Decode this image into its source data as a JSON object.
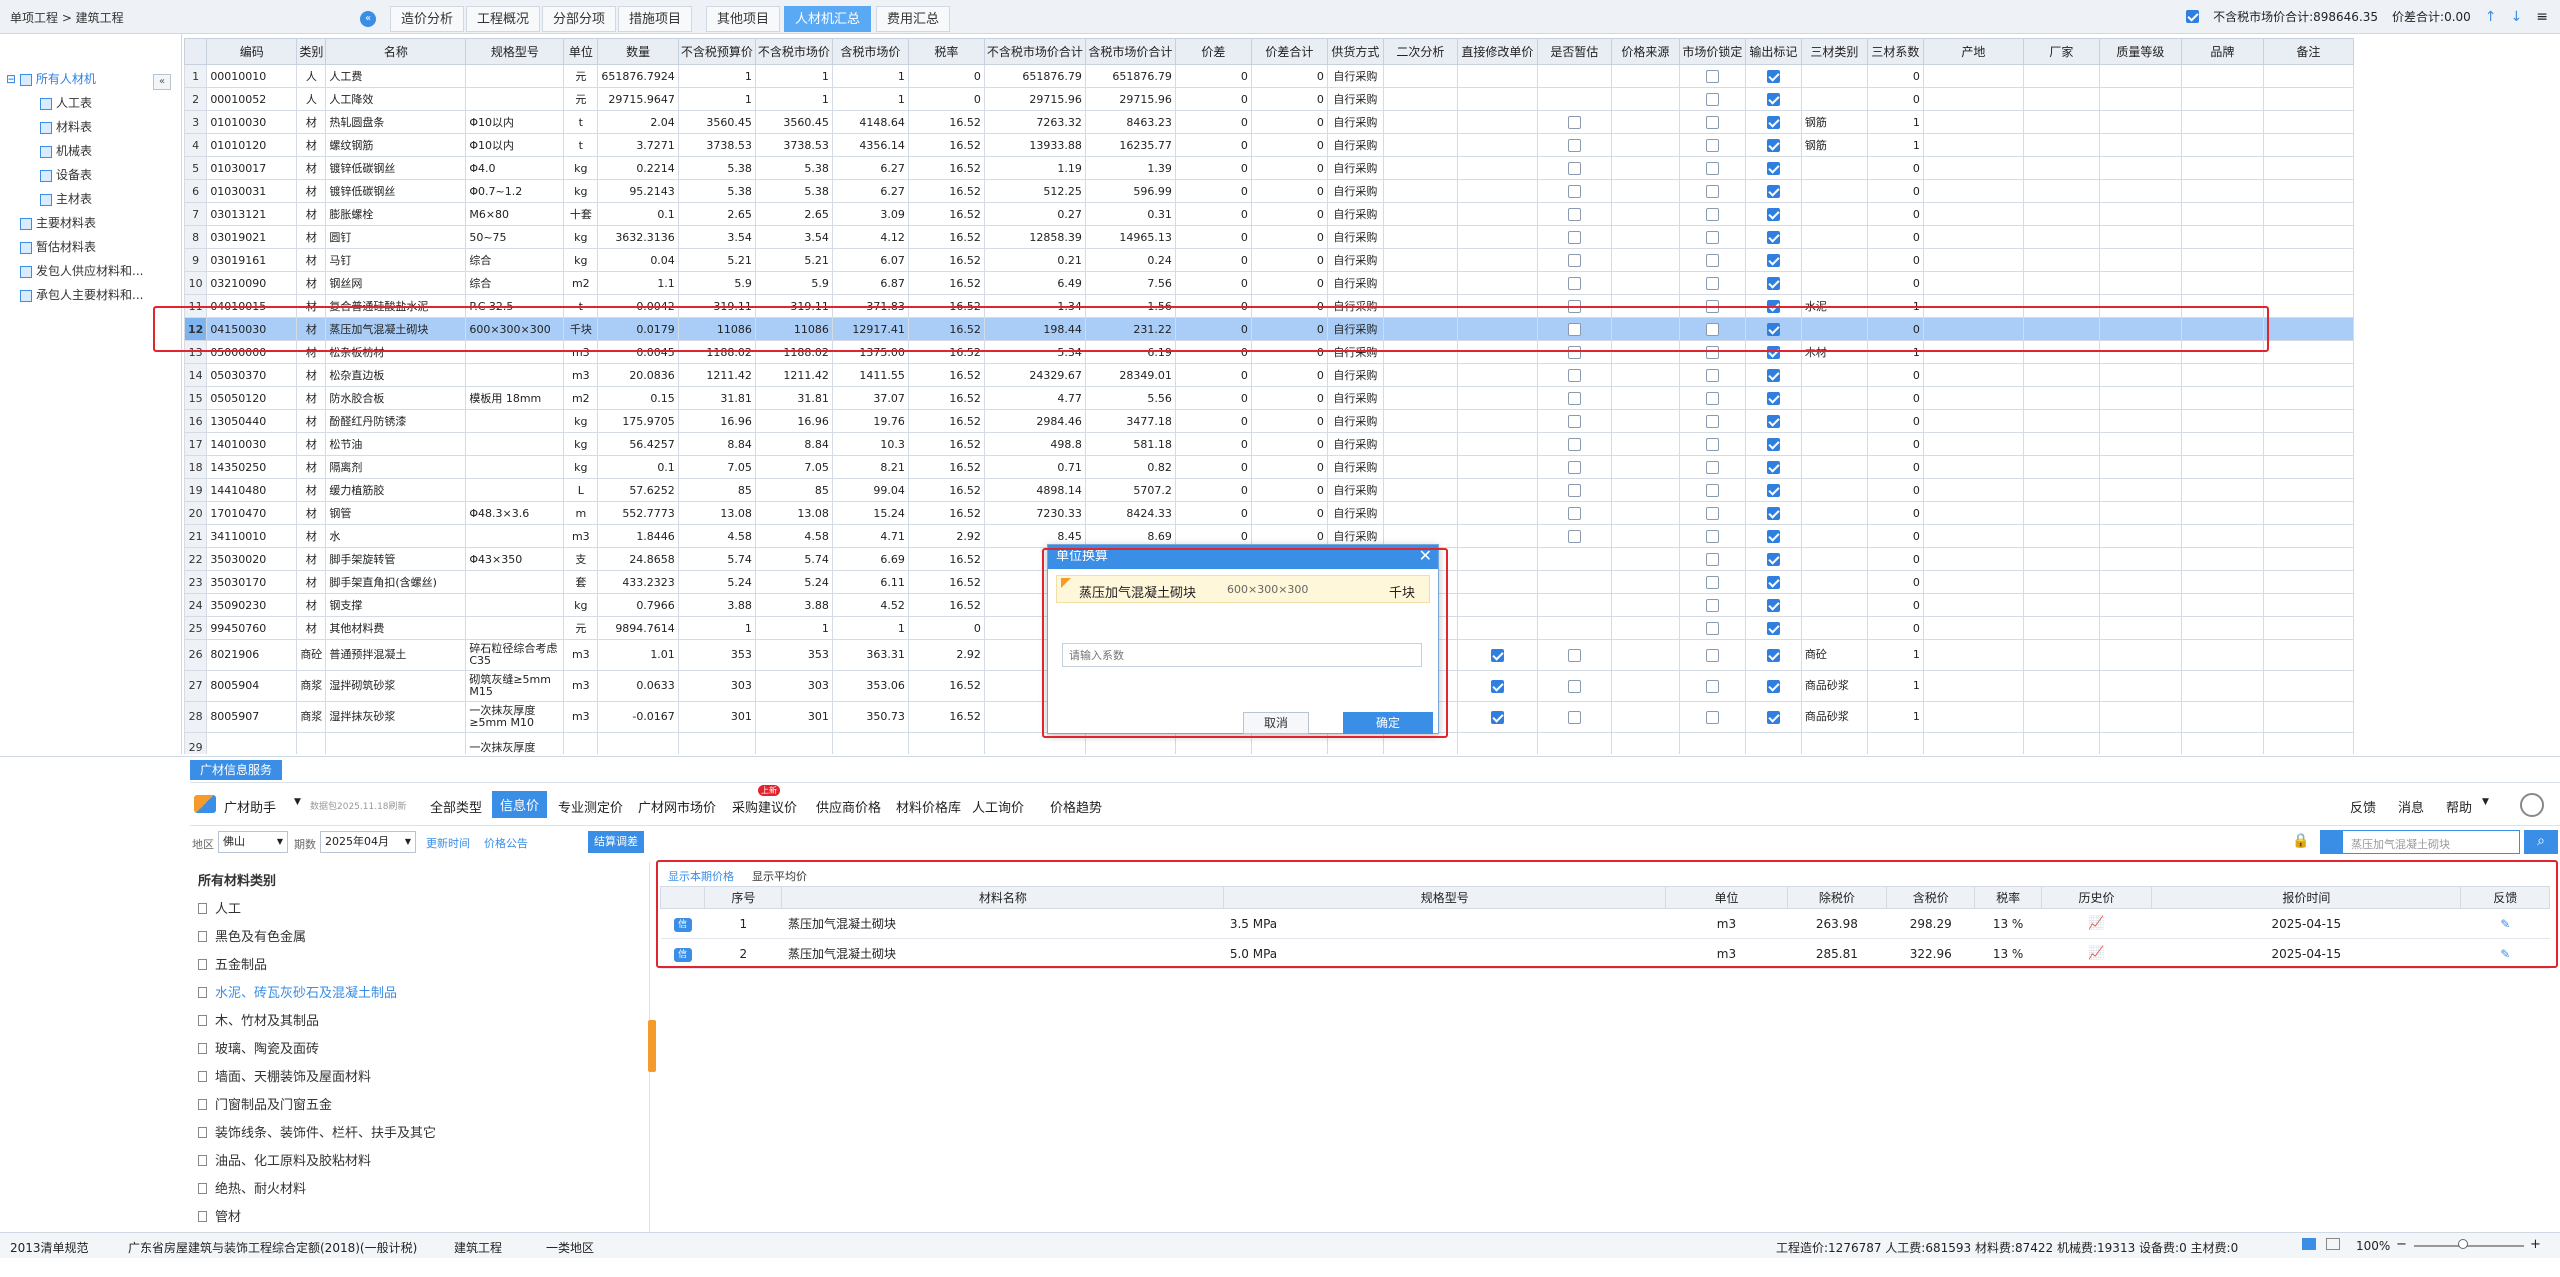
{
  "topbar": {
    "breadcrumb": "单项工程 > 建筑工程",
    "tabs": [
      "造价分析",
      "工程概况",
      "分部分项",
      "措施项目",
      "其他项目",
      "人材机汇总",
      "费用汇总"
    ],
    "active_tab": "人材机汇总",
    "total_label": "不含税市场价合计:898646.35",
    "diff_label": "价差合计:0.00"
  },
  "tree": {
    "root": "所有人材机",
    "children": [
      "人工表",
      "材料表",
      "机械表",
      "设备表",
      "主材表"
    ],
    "others": [
      "主要材料表",
      "暂估材料表",
      "发包人供应材料和...",
      "承包人主要材料和..."
    ]
  },
  "grid": {
    "columns": [
      "",
      "编码",
      "类别",
      "名称",
      "规格型号",
      "单位",
      "数量",
      "不含税预算价",
      "不含税市场价",
      "含税市场价",
      "税率",
      "不含税市场价合计",
      "含税市场价合计",
      "价差",
      "价差合计",
      "供货方式",
      "二次分析",
      "直接修改单价",
      "是否暂估",
      "价格来源",
      "市场价锁定",
      "输出标记",
      "三材类别",
      "三材系数",
      "产地",
      "厂家",
      "质量等级",
      "品牌",
      "备注"
    ],
    "rows": [
      [
        "1",
        "00010010",
        "人",
        "人工费",
        "",
        "元",
        "651876.7924",
        "1",
        "1",
        "1",
        "0",
        "651876.79",
        "651876.79",
        "0",
        "0",
        "自行采购",
        "",
        "",
        "",
        "",
        "",
        "1",
        "",
        "0"
      ],
      [
        "2",
        "00010052",
        "人",
        "人工降效",
        "",
        "元",
        "29715.9647",
        "1",
        "1",
        "1",
        "0",
        "29715.96",
        "29715.96",
        "0",
        "0",
        "自行采购",
        "",
        "",
        "",
        "",
        "",
        "1",
        "",
        "0"
      ],
      [
        "3",
        "01010030",
        "材",
        "热轧圆盘条",
        "Φ10以内",
        "t",
        "2.04",
        "3560.45",
        "3560.45",
        "4148.64",
        "16.52",
        "7263.32",
        "8463.23",
        "0",
        "0",
        "自行采购",
        "",
        "",
        "0",
        "",
        "0",
        "1",
        "钢筋",
        "1"
      ],
      [
        "4",
        "01010120",
        "材",
        "螺纹钢筋",
        "Φ10以内",
        "t",
        "3.7271",
        "3738.53",
        "3738.53",
        "4356.14",
        "16.52",
        "13933.88",
        "16235.77",
        "0",
        "0",
        "自行采购",
        "",
        "",
        "0",
        "",
        "0",
        "1",
        "钢筋",
        "1"
      ],
      [
        "5",
        "01030017",
        "材",
        "镀锌低碳钢丝",
        "Φ4.0",
        "kg",
        "0.2214",
        "5.38",
        "5.38",
        "6.27",
        "16.52",
        "1.19",
        "1.39",
        "0",
        "0",
        "自行采购",
        "",
        "",
        "0",
        "",
        "0",
        "1",
        "",
        "0"
      ],
      [
        "6",
        "01030031",
        "材",
        "镀锌低碳钢丝",
        "Φ0.7~1.2",
        "kg",
        "95.2143",
        "5.38",
        "5.38",
        "6.27",
        "16.52",
        "512.25",
        "596.99",
        "0",
        "0",
        "自行采购",
        "",
        "",
        "0",
        "",
        "0",
        "1",
        "",
        "0"
      ],
      [
        "7",
        "03013121",
        "材",
        "膨胀螺栓",
        "M6×80",
        "十套",
        "0.1",
        "2.65",
        "2.65",
        "3.09",
        "16.52",
        "0.27",
        "0.31",
        "0",
        "0",
        "自行采购",
        "",
        "",
        "0",
        "",
        "0",
        "1",
        "",
        "0"
      ],
      [
        "8",
        "03019021",
        "材",
        "圆钉",
        "50~75",
        "kg",
        "3632.3136",
        "3.54",
        "3.54",
        "4.12",
        "16.52",
        "12858.39",
        "14965.13",
        "0",
        "0",
        "自行采购",
        "",
        "",
        "0",
        "",
        "0",
        "1",
        "",
        "0"
      ],
      [
        "9",
        "03019161",
        "材",
        "马钉",
        "综合",
        "kg",
        "0.04",
        "5.21",
        "5.21",
        "6.07",
        "16.52",
        "0.21",
        "0.24",
        "0",
        "0",
        "自行采购",
        "",
        "",
        "0",
        "",
        "0",
        "1",
        "",
        "0"
      ],
      [
        "10",
        "03210090",
        "材",
        "钢丝网",
        "综合",
        "m2",
        "1.1",
        "5.9",
        "5.9",
        "6.87",
        "16.52",
        "6.49",
        "7.56",
        "0",
        "0",
        "自行采购",
        "",
        "",
        "0",
        "",
        "0",
        "1",
        "",
        "0"
      ],
      [
        "11",
        "04010015",
        "材",
        "复合普通硅酸盐水泥",
        "P.C 32.5",
        "t",
        "0.0042",
        "319.11",
        "319.11",
        "371.83",
        "16.52",
        "1.34",
        "1.56",
        "0",
        "0",
        "自行采购",
        "",
        "",
        "0",
        "",
        "0",
        "1",
        "水泥",
        "1"
      ],
      [
        "12",
        "04150030",
        "材",
        "蒸压加气混凝土砌块",
        "600×300×300",
        "千块",
        "0.0179",
        "11086",
        "11086",
        "12917.41",
        "16.52",
        "198.44",
        "231.22",
        "0",
        "0",
        "自行采购",
        "",
        "",
        "0",
        "",
        "0",
        "1",
        "",
        "0"
      ],
      [
        "13",
        "05000000",
        "材",
        "松杂板枋材",
        "",
        "m3",
        "0.0045",
        "1188.02",
        "1188.02",
        "1375.00",
        "16.52",
        "5.34",
        "6.19",
        "0",
        "0",
        "自行采购",
        "",
        "",
        "0",
        "",
        "0",
        "1",
        "木材",
        "1"
      ],
      [
        "14",
        "05030370",
        "材",
        "松杂直边板",
        "",
        "m3",
        "20.0836",
        "1211.42",
        "1211.42",
        "1411.55",
        "16.52",
        "24329.67",
        "28349.01",
        "0",
        "0",
        "自行采购",
        "",
        "",
        "0",
        "",
        "0",
        "1",
        "",
        "0"
      ],
      [
        "15",
        "05050120",
        "材",
        "防水胶合板",
        "模板用 18mm",
        "m2",
        "0.15",
        "31.81",
        "31.81",
        "37.07",
        "16.52",
        "4.77",
        "5.56",
        "0",
        "0",
        "自行采购",
        "",
        "",
        "0",
        "",
        "0",
        "1",
        "",
        "0"
      ],
      [
        "16",
        "13050440",
        "材",
        "酚醛红丹防锈漆",
        "",
        "kg",
        "175.9705",
        "16.96",
        "16.96",
        "19.76",
        "16.52",
        "2984.46",
        "3477.18",
        "0",
        "0",
        "自行采购",
        "",
        "",
        "0",
        "",
        "0",
        "1",
        "",
        "0"
      ],
      [
        "17",
        "14010030",
        "材",
        "松节油",
        "",
        "kg",
        "56.4257",
        "8.84",
        "8.84",
        "10.3",
        "16.52",
        "498.8",
        "581.18",
        "0",
        "0",
        "自行采购",
        "",
        "",
        "0",
        "",
        "0",
        "1",
        "",
        "0"
      ],
      [
        "18",
        "14350250",
        "材",
        "隔离剂",
        "",
        "kg",
        "0.1",
        "7.05",
        "7.05",
        "8.21",
        "16.52",
        "0.71",
        "0.82",
        "0",
        "0",
        "自行采购",
        "",
        "",
        "0",
        "",
        "0",
        "1",
        "",
        "0"
      ],
      [
        "19",
        "14410480",
        "材",
        "缓力植筋胶",
        "",
        "L",
        "57.6252",
        "85",
        "85",
        "99.04",
        "16.52",
        "4898.14",
        "5707.2",
        "0",
        "0",
        "自行采购",
        "",
        "",
        "0",
        "",
        "0",
        "1",
        "",
        "0"
      ],
      [
        "20",
        "17010470",
        "材",
        "钢管",
        "Φ48.3×3.6",
        "m",
        "552.7773",
        "13.08",
        "13.08",
        "15.24",
        "16.52",
        "7230.33",
        "8424.33",
        "0",
        "0",
        "自行采购",
        "",
        "",
        "0",
        "",
        "0",
        "1",
        "",
        "0"
      ],
      [
        "21",
        "34110010",
        "材",
        "水",
        "",
        "m3",
        "1.8446",
        "4.58",
        "4.58",
        "4.71",
        "2.92",
        "8.45",
        "8.69",
        "0",
        "0",
        "自行采购",
        "",
        "",
        "0",
        "",
        "0",
        "1",
        "",
        "0"
      ],
      [
        "22",
        "35030020",
        "材",
        "脚手架旋转管",
        "Φ43×350",
        "支",
        "24.8658",
        "5.74",
        "5.74",
        "6.69",
        "16.52",
        "",
        "",
        "",
        "",
        "",
        "",
        "",
        "",
        "",
        "",
        "1",
        "",
        "0"
      ],
      [
        "23",
        "35030170",
        "材",
        "脚手架直角扣(含螺丝)",
        "",
        "套",
        "433.2323",
        "5.24",
        "5.24",
        "6.11",
        "16.52",
        "",
        "",
        "",
        "",
        "",
        "",
        "",
        "",
        "",
        "",
        "1",
        "",
        "0"
      ],
      [
        "24",
        "35090230",
        "材",
        "钢支撑",
        "",
        "kg",
        "0.7966",
        "3.88",
        "3.88",
        "4.52",
        "16.52",
        "",
        "",
        "",
        "",
        "",
        "",
        "",
        "",
        "",
        "",
        "1",
        "",
        "0"
      ],
      [
        "25",
        "99450760",
        "材",
        "其他材料费",
        "",
        "元",
        "9894.7614",
        "1",
        "1",
        "1",
        "0",
        "",
        "",
        "",
        "",
        "",
        "",
        "",
        "",
        "",
        "",
        "1",
        "",
        "0"
      ],
      [
        "26",
        "8021906",
        "商砼",
        "普通预拌混凝土",
        "碎石粒径综合考虑 C35",
        "m3",
        "1.01",
        "353",
        "353",
        "363.31",
        "2.92",
        "",
        "",
        "",
        "",
        "",
        "",
        "1",
        "0",
        "",
        "0",
        "1",
        "商砼",
        "1"
      ],
      [
        "27",
        "8005904",
        "商浆",
        "湿拌砌筑砂浆",
        "砌筑灰缝≥5mm M15",
        "m3",
        "0.0633",
        "303",
        "303",
        "353.06",
        "16.52",
        "",
        "",
        "",
        "",
        "",
        "",
        "1",
        "0",
        "",
        "0",
        "1",
        "商品砂浆",
        "1"
      ],
      [
        "28",
        "8005907",
        "商浆",
        "湿拌抹灰砂浆",
        "一次抹灰厚度≥5mm M10",
        "m3",
        "-0.0167",
        "301",
        "301",
        "350.73",
        "16.52",
        "",
        "",
        "",
        "",
        "",
        "",
        "1",
        "0",
        "",
        "0",
        "1",
        "商品砂浆",
        "1"
      ],
      [
        "29",
        "",
        "",
        "",
        "一次抹灰厚度",
        "",
        "",
        "",
        "",
        "",
        "",
        "",
        "",
        "",
        "",
        "",
        "",
        "",
        "",
        "",
        "",
        "",
        "",
        ""
      ]
    ]
  },
  "dialog": {
    "title": "单位换算",
    "material": "蒸压加气混凝土砌块",
    "spec": "600×300×300",
    "unit": "千块",
    "input_placeholder": "请输入系数",
    "cancel": "取消",
    "ok": "确定"
  },
  "bottom": {
    "panel_tab": "广材信息服务",
    "assistant": "广材助手",
    "data_date": "数据包2025.11.18刷新",
    "toolbar": [
      "全部类型",
      "信息价",
      "专业测定价",
      "广材网市场价",
      "采购建议价",
      "供应商价格",
      "材料价格库",
      "人工询价",
      "价格趋势"
    ],
    "active_toolbar": "信息价",
    "new_badge": "上新",
    "right_links": [
      "反馈",
      "消息",
      "帮助"
    ],
    "region_label": "地区",
    "region": "佛山",
    "period_label": "期数",
    "period": "2025年04月",
    "update_time": "更新时间",
    "price_notice": "价格公告",
    "settle": "结算调差",
    "search_placeholder": "蒸压加气混凝土砌块",
    "category_title": "所有材料类别",
    "categories": [
      "人工",
      "黑色及有色金属",
      "五金制品",
      "水泥、砖瓦灰砂石及混凝土制品",
      "木、竹材及其制品",
      "玻璃、陶瓷及面砖",
      "墙面、天棚装饰及屋面材料",
      "门窗制品及门窗五金",
      "装饰线条、装饰件、栏杆、扶手及其它",
      "油品、化工原料及胶粘材料",
      "绝热、耐火材料",
      "管材"
    ],
    "selected_category": "水泥、砖瓦灰砂石及混凝土制品",
    "price_tabs": [
      "显示本期价格",
      "显示平均价"
    ],
    "price_columns": [
      "",
      "序号",
      "材料名称",
      "规格型号",
      "单位",
      "除税价",
      "含税价",
      "税率",
      "历史价",
      "报价时间",
      "反馈"
    ],
    "price_rows": [
      {
        "tag": "信",
        "no": "1",
        "name": "蒸压加气混凝土砌块",
        "spec": "3.5 MPa",
        "unit": "m3",
        "ex_tax": "263.98",
        "inc_tax": "298.29",
        "rate": "13 %",
        "date": "2025-04-15"
      },
      {
        "tag": "信",
        "no": "2",
        "name": "蒸压加气混凝土砌块",
        "spec": "5.0 MPa",
        "unit": "m3",
        "ex_tax": "285.81",
        "inc_tax": "322.96",
        "rate": "13 %",
        "date": "2025-04-15"
      }
    ]
  },
  "status": {
    "items": [
      "2013清单规范",
      "广东省房屋建筑与装饰工程综合定额(2018)(一般计税)",
      "建筑工程",
      "一类地区"
    ],
    "summary": "工程造价:1276787  人工费:681593  材料费:87422  机械费:19313  设备费:0  主材费:0",
    "zoom": "100%"
  },
  "colors": {
    "accent": "#3a8ee6",
    "highlight": "#e0252f",
    "selected_row": "#a9cdf7"
  }
}
